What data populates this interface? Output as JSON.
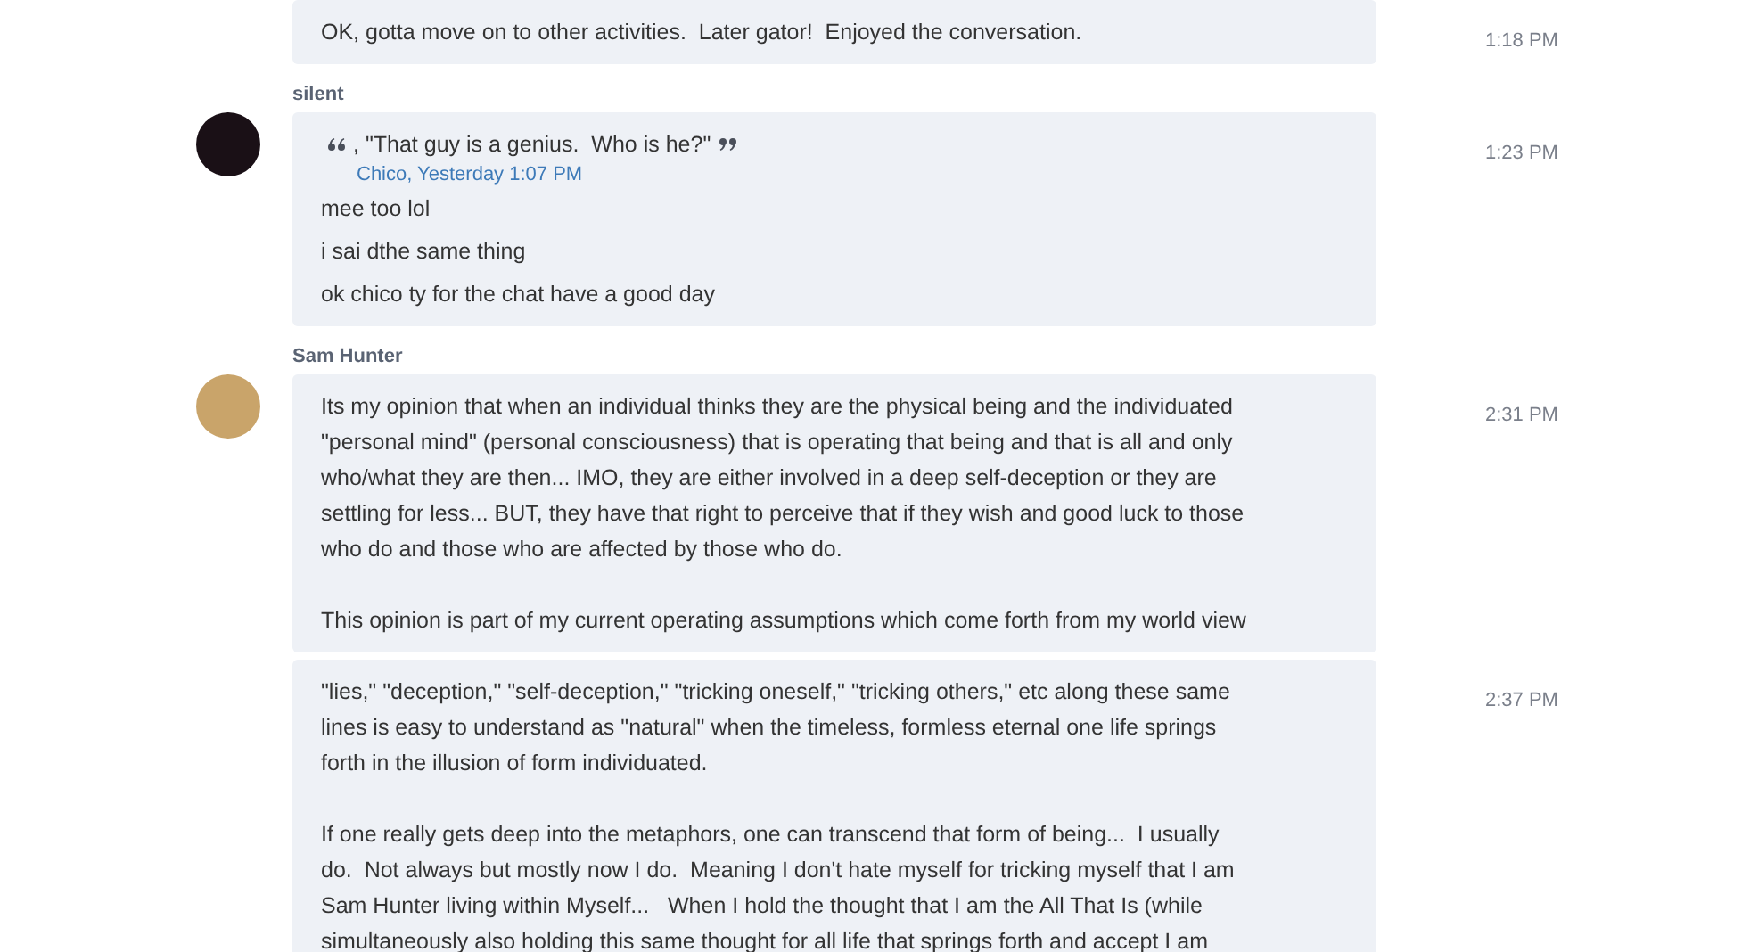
{
  "groups": [
    {
      "messages": [
        {
          "time": "1:18 PM",
          "paragraphs": [
            [
              "OK, gotta move on to other activities.  Later gator!  Enjoyed the conversation."
            ]
          ]
        }
      ]
    },
    {
      "sender": "silent",
      "messages": [
        {
          "time": "1:23 PM",
          "quote": {
            "text": ", \"That guy is a genius.  Who is he?\"",
            "author": "Chico",
            "when": ", Yesterday 1:07 PM"
          },
          "paragraphs": [
            [
              "mee too lol"
            ],
            [
              "i sai dthe same thing"
            ],
            [
              "ok chico ty for the chat have a good day"
            ]
          ]
        }
      ]
    },
    {
      "sender": "Sam Hunter",
      "messages": [
        {
          "time": "2:31 PM",
          "paragraphs": [
            [
              "Its my opinion that when an individual thinks they are the physical being and the individuated",
              "\"personal mind\" (personal consciousness) that is operating that being and that is all and only",
              "who/what they are then... IMO, they are either involved in a deep self-deception or they are",
              "settling for less... BUT, they have that right to perceive that if they wish and good luck to those",
              "who do and those who are affected by those who do."
            ],
            [
              "This opinion is part of my current operating assumptions which come forth from my world view"
            ]
          ]
        },
        {
          "time": "2:37 PM",
          "paragraphs": [
            [
              "\"lies,\" \"deception,\" \"self-deception,\" \"tricking oneself,\" \"tricking others,\" etc along these same",
              "lines is easy to understand as \"natural\" when the timeless, formless eternal one life springs",
              "forth in the illusion of form individuated."
            ],
            [
              "If one really gets deep into the metaphors, one can transcend that form of being...  I usually",
              "do.  Not always but mostly now I do.  Meaning I don't hate myself for tricking myself that I am",
              "Sam Hunter living within Myself...   When I hold the thought that I am the All That Is (while",
              "simultaneously also holding this same thought for all life that springs forth and accept I am"
            ]
          ]
        }
      ]
    }
  ]
}
